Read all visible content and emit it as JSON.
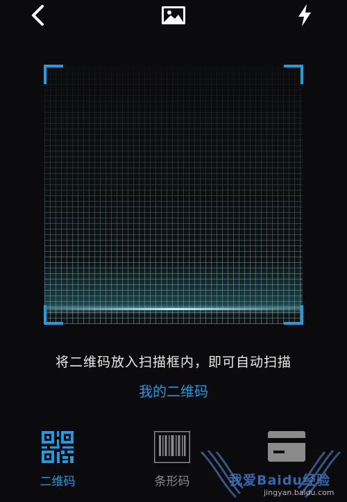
{
  "topbar": {
    "back_icon": "chevron-left-icon",
    "gallery_icon": "image-icon",
    "flash_icon": "lightning-icon"
  },
  "scanner": {
    "hint": "将二维码放入扫描框内，即可自动扫描",
    "my_qr_link": "我的二维码",
    "accent_color": "#1a9fe0"
  },
  "tabs": [
    {
      "label": "二维码",
      "icon": "qr-code-icon",
      "active": true
    },
    {
      "label": "条形码",
      "icon": "barcode-icon",
      "active": false
    },
    {
      "label": "",
      "icon": "card-icon",
      "active": false
    }
  ],
  "watermark": {
    "text": "我爱Baidu经验",
    "url": "jingyan.baidu.com"
  }
}
